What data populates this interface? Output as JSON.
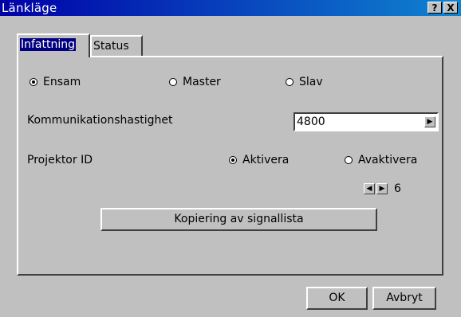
{
  "window": {
    "title": "Länkläge",
    "help": "?",
    "close": "X"
  },
  "tabs": [
    {
      "label": "Infattning",
      "active": true
    },
    {
      "label": "Status",
      "active": false
    }
  ],
  "mode": {
    "options": [
      {
        "label": "Ensam",
        "selected": true
      },
      {
        "label": "Master",
        "selected": false
      },
      {
        "label": "Slav",
        "selected": false
      }
    ]
  },
  "comm": {
    "label": "Kommunikationshastighet",
    "value": "4800",
    "next_icon": "arrow-right-icon"
  },
  "projector": {
    "label": "Projektor ID",
    "options": [
      {
        "label": "Aktivera",
        "selected": true
      },
      {
        "label": "Avaktivera",
        "selected": false
      }
    ],
    "id_value": "6",
    "prev_icon": "arrow-left-icon",
    "next_icon": "arrow-right-icon"
  },
  "copy_button": "Kopiering av signallista",
  "footer": {
    "ok": "OK",
    "cancel": "Avbryt"
  }
}
